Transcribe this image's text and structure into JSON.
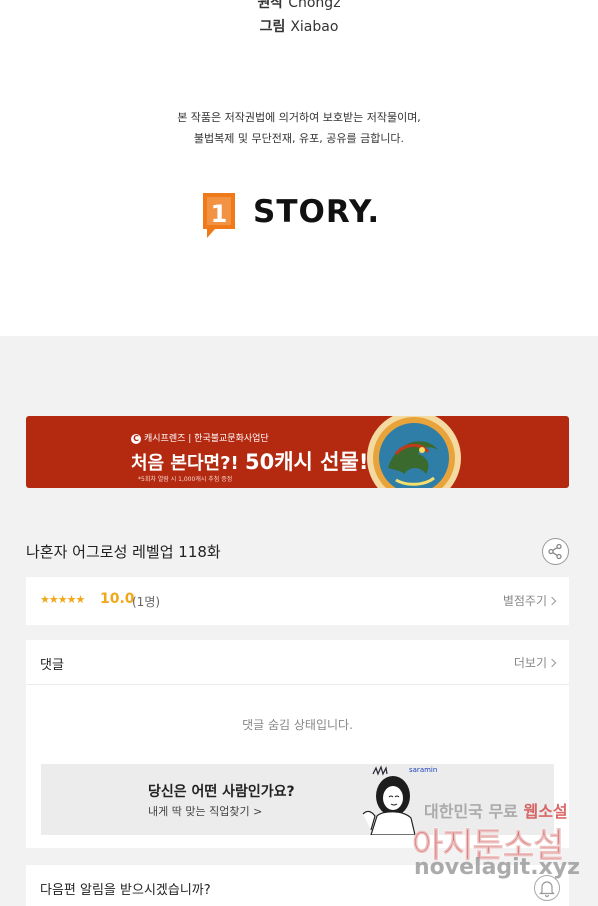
{
  "credits": {
    "writer_role": "원작",
    "writer_name": "Chongz",
    "artist_role": "그림",
    "artist_name": "Xiabao"
  },
  "copyright": {
    "line1": "본 작품은 저작권법에 의거하여 보호받는 저작물이며,",
    "line2": "불법복제 및 무단전재, 유포, 공유를 금합니다."
  },
  "publisher": {
    "logo_text": "STORY.",
    "mark_digit": "1",
    "accent": "#f07a1a"
  },
  "banner": {
    "brand_left": "캐시프렌즈",
    "brand_right": "한국불교문화사업단",
    "title_prefix": "처음 본다면?!",
    "title_main": "50캐시 선물!!",
    "note": "*5회차 열람 시 1,000캐시 추첨 증정",
    "bg_color": "#b42a10"
  },
  "episode": {
    "title": "나혼자 어그로성 레벨업 118화"
  },
  "rating": {
    "stars": "★★★★★",
    "score": "10.0",
    "count": "(1명)",
    "rate_label": "별점주기",
    "star_color": "#f0a81a"
  },
  "comments": {
    "label": "댓글",
    "more_label": "더보기",
    "hidden_message": "댓글 숨김 상태입니다."
  },
  "ad": {
    "title": "당신은 어떤 사람인가요?",
    "subtitle": "내게 딱 맞는 직업찾기 >",
    "brand": "saramin"
  },
  "alert": {
    "label": "다음편 알림을 받으시겠습니까?"
  },
  "watermark": {
    "line1_a": "대한민국 무료",
    "line1_b": "웹소설",
    "line2": "아지툰소설",
    "line3": "novelagit.xyz"
  }
}
